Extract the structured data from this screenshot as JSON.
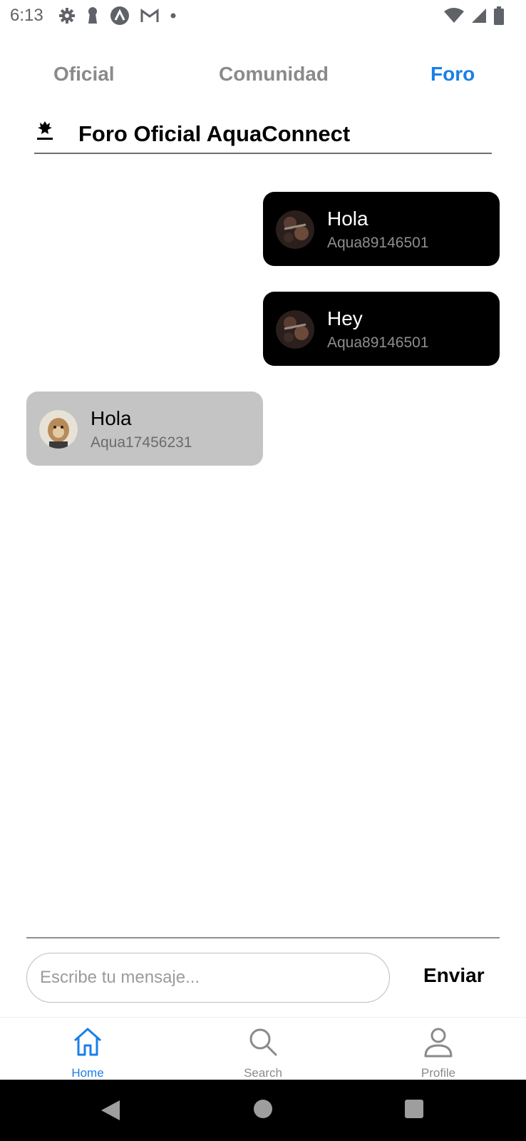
{
  "status_bar": {
    "time": "6:13",
    "icons_left": [
      "settings-icon",
      "keyhole-icon",
      "app-circle-icon",
      "gmail-icon",
      "dot-icon"
    ],
    "icons_right": [
      "wifi-icon",
      "signal-icon",
      "battery-icon"
    ]
  },
  "tabs": [
    {
      "label": "Oficial",
      "active": false
    },
    {
      "label": "Comunidad",
      "active": false
    },
    {
      "label": "Foro",
      "active": true
    }
  ],
  "forum": {
    "title": "Foro Oficial AquaConnect"
  },
  "messages": [
    {
      "text": "Hola",
      "user": "Aqua89146501",
      "mine": true
    },
    {
      "text": "Hey",
      "user": "Aqua89146501",
      "mine": true
    },
    {
      "text": "Hola",
      "user": "Aqua17456231",
      "mine": false
    }
  ],
  "composer": {
    "placeholder": "Escribe tu mensaje...",
    "value": "",
    "send_label": "Enviar"
  },
  "bottom_nav": [
    {
      "label": "Home",
      "icon": "home-icon",
      "active": true
    },
    {
      "label": "Search",
      "icon": "search-icon",
      "active": false
    },
    {
      "label": "Profile",
      "icon": "profile-icon",
      "active": false
    }
  ],
  "colors": {
    "accent": "#1a7fe8",
    "tab_inactive": "#8a8a8a",
    "bubble_mine": "#000000",
    "bubble_other": "#c4c4c4"
  }
}
